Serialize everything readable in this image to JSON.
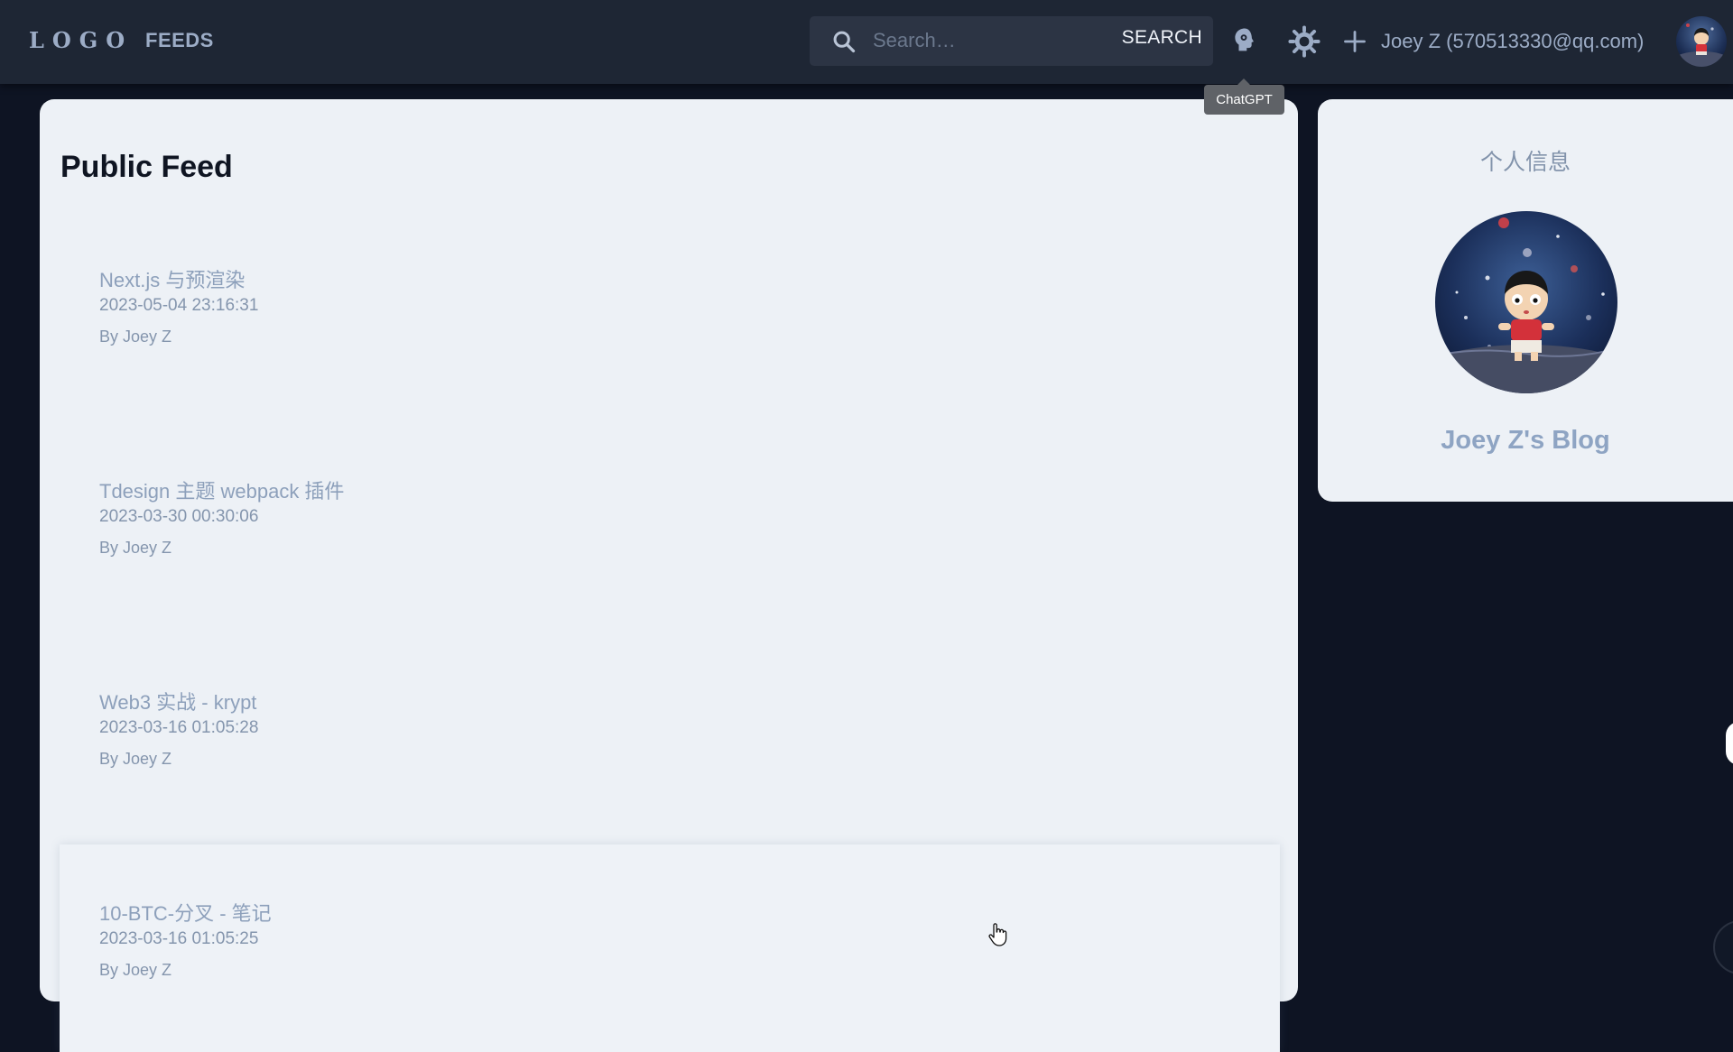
{
  "header": {
    "logo": "LOGO",
    "nav_feeds": "FEEDS",
    "search": {
      "placeholder": "Search…",
      "button_label": "SEARCH"
    },
    "chatgpt_icon": "chatgpt-brain-icon",
    "theme_icon": "sun-icon",
    "add_icon": "plus-icon",
    "user_label": "Joey Z (570513330@qq.com)"
  },
  "tooltip": {
    "text": "ChatGPT"
  },
  "feed": {
    "title": "Public Feed",
    "items": [
      {
        "title": "Next.js 与预渲染",
        "date": "2023-05-04 23:16:31",
        "author": "By Joey Z"
      },
      {
        "title": "Tdesign 主题 webpack 插件",
        "date": "2023-03-30 00:30:06",
        "author": "By Joey Z"
      },
      {
        "title": "Web3 实战 - krypt",
        "date": "2023-03-16 01:05:28",
        "author": "By Joey Z"
      },
      {
        "title": "10-BTC-分叉 - 笔记",
        "date": "2023-03-16 01:05:25",
        "author": "By Joey Z"
      }
    ]
  },
  "profile": {
    "heading": "个人信息",
    "blog_name": "Joey Z's Blog"
  },
  "colors": {
    "page_bg": "#0e1423",
    "topbar_bg": "#1e2634",
    "card_bg": "#edf1f6",
    "link_text": "#8da0bb"
  }
}
